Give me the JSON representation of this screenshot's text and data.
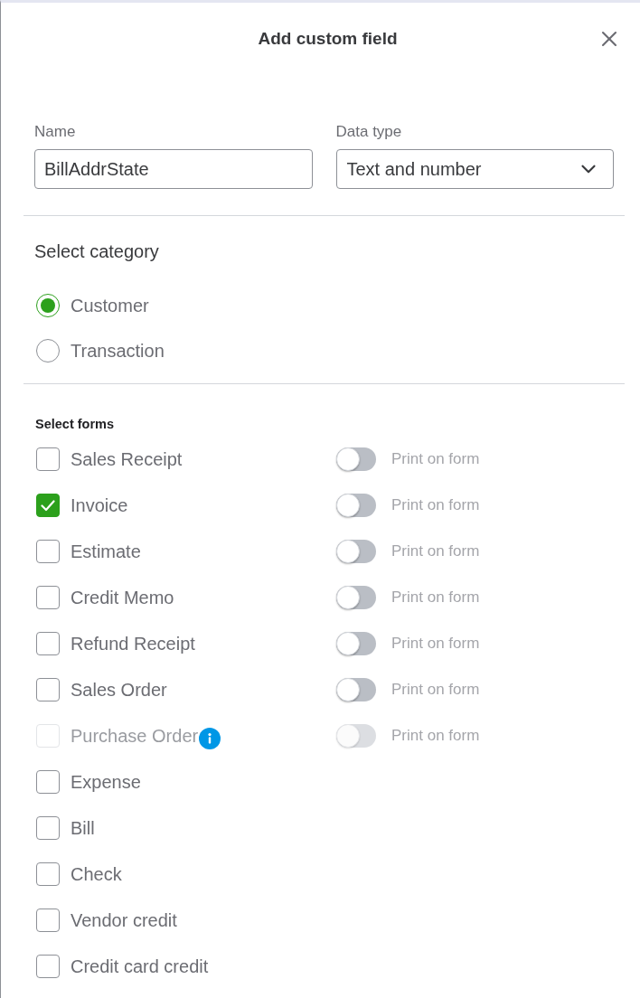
{
  "dialog": {
    "title": "Add custom field"
  },
  "fields": [
    {
      "kind": "text",
      "label": "Name",
      "value": "BillAddrState"
    },
    {
      "kind": "select",
      "label": "Data type",
      "value": "Text and number"
    }
  ],
  "category": {
    "heading": "Select category",
    "options": [
      {
        "label": "Customer",
        "selected": true
      },
      {
        "label": "Transaction",
        "selected": false
      }
    ]
  },
  "forms": {
    "heading": "Select forms",
    "items": [
      {
        "label": "Sales Receipt",
        "checked": false,
        "disabled": false,
        "info": false,
        "print": {
          "label": "Print on form",
          "on": false
        }
      },
      {
        "label": "Invoice",
        "checked": true,
        "disabled": false,
        "info": false,
        "print": {
          "label": "Print on form",
          "on": false
        }
      },
      {
        "label": "Estimate",
        "checked": false,
        "disabled": false,
        "info": false,
        "print": {
          "label": "Print on form",
          "on": false
        }
      },
      {
        "label": "Credit Memo",
        "checked": false,
        "disabled": false,
        "info": false,
        "print": {
          "label": "Print on form",
          "on": false
        }
      },
      {
        "label": "Refund Receipt",
        "checked": false,
        "disabled": false,
        "info": false,
        "print": {
          "label": "Print on form",
          "on": false
        }
      },
      {
        "label": "Sales Order",
        "checked": false,
        "disabled": false,
        "info": false,
        "print": {
          "label": "Print on form",
          "on": false
        }
      },
      {
        "label": "Purchase Order",
        "checked": false,
        "disabled": true,
        "info": true,
        "print": {
          "label": "Print on form",
          "on": false
        }
      },
      {
        "label": "Expense",
        "checked": false,
        "disabled": false,
        "info": false
      },
      {
        "label": "Bill",
        "checked": false,
        "disabled": false,
        "info": false
      },
      {
        "label": "Check",
        "checked": false,
        "disabled": false,
        "info": false
      },
      {
        "label": "Vendor credit",
        "checked": false,
        "disabled": false,
        "info": false
      },
      {
        "label": "Credit card credit",
        "checked": false,
        "disabled": false,
        "info": false
      }
    ]
  }
}
